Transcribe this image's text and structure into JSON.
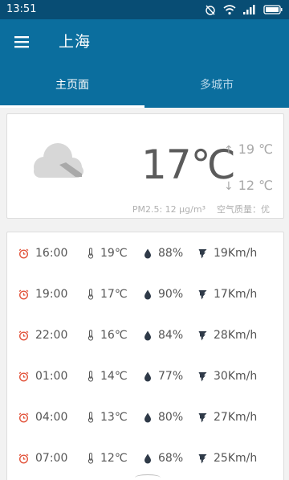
{
  "status_bar": {
    "time": "13:51"
  },
  "app_bar": {
    "title": "上海"
  },
  "tabs": [
    {
      "label": "主页面",
      "active": true
    },
    {
      "label": "多城市",
      "active": false
    }
  ],
  "current": {
    "condition_icon": "cloudy-icon",
    "temperature": "17℃",
    "high": "19 ℃",
    "low": "12 ℃",
    "pm25": "PM2.5: 12 μg/m³",
    "air_quality": "空气质量：优"
  },
  "hourly": [
    {
      "time": "16:00",
      "temp": "19℃",
      "humidity": "88%",
      "wind": "19Km/h"
    },
    {
      "time": "19:00",
      "temp": "17℃",
      "humidity": "90%",
      "wind": "17Km/h"
    },
    {
      "time": "22:00",
      "temp": "16℃",
      "humidity": "84%",
      "wind": "28Km/h"
    },
    {
      "time": "01:00",
      "temp": "14℃",
      "humidity": "77%",
      "wind": "30Km/h"
    },
    {
      "time": "04:00",
      "temp": "13℃",
      "humidity": "80%",
      "wind": "27Km/h"
    },
    {
      "time": "07:00",
      "temp": "12℃",
      "humidity": "68%",
      "wind": "25Km/h"
    }
  ],
  "colors": {
    "primary": "#0b6e9e",
    "status_bar": "#084d74",
    "clock_icon": "#e2543c",
    "icon_dark": "#2f3a48"
  }
}
